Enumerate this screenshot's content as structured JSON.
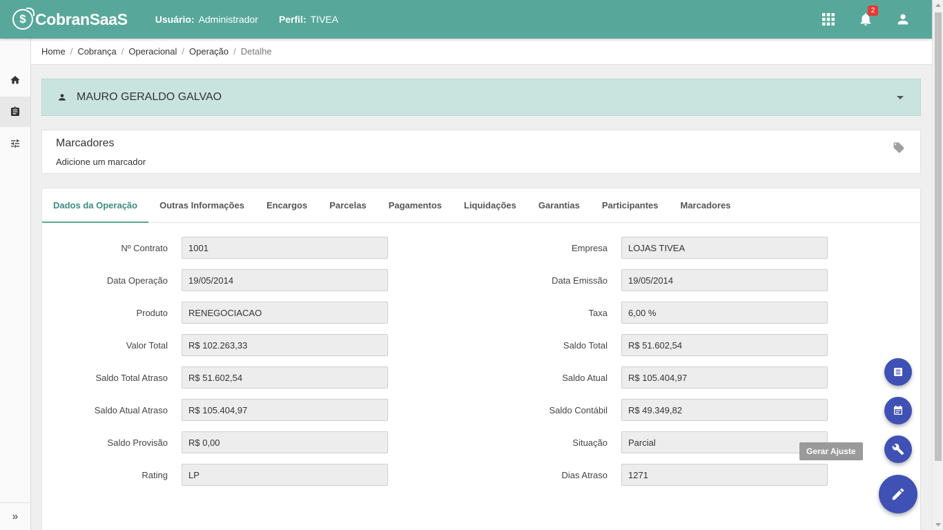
{
  "header": {
    "logo_text": "CobranSaaS",
    "logo_symbol": "$",
    "user_label": "Usuário:",
    "user_value": "Administrador",
    "profile_label": "Perfil:",
    "profile_value": "TIVEA",
    "notification_count": "2",
    "icons": [
      "apps-grid-icon",
      "bell-icon",
      "account-icon"
    ],
    "color": "#57a89a"
  },
  "sidebar": {
    "items": [
      "home-icon",
      "clipboard-icon",
      "sliders-icon"
    ],
    "expand_label": "»"
  },
  "breadcrumb": {
    "items": [
      "Home",
      "Cobrança",
      "Operacional",
      "Operação"
    ],
    "current": "Detalhe"
  },
  "client": {
    "name": "MAURO GERALDO GALVAO"
  },
  "tags": {
    "title": "Marcadores",
    "add_label": "Adicione um marcador"
  },
  "tabs": [
    "Dados da Operação",
    "Outras Informações",
    "Encargos",
    "Parcelas",
    "Pagamentos",
    "Liquidações",
    "Garantias",
    "Participantes",
    "Marcadores"
  ],
  "active_tab": "Dados da Operação",
  "form": {
    "left": [
      {
        "label": "Nº Contrato",
        "value": "1001"
      },
      {
        "label": "Data Operação",
        "value": "19/05/2014"
      },
      {
        "label": "Produto",
        "value": "RENEGOCIACAO"
      },
      {
        "label": "Valor Total",
        "value": "R$ 102.263,33"
      },
      {
        "label": "Saldo Total Atraso",
        "value": "R$ 51.602,54"
      },
      {
        "label": "Saldo Atual Atraso",
        "value": "R$ 105.404,97"
      },
      {
        "label": "Saldo Provisão",
        "value": "R$ 0,00"
      },
      {
        "label": "Rating",
        "value": "LP"
      }
    ],
    "right": [
      {
        "label": "Empresa",
        "value": "LOJAS TIVEA"
      },
      {
        "label": "Data Emissão",
        "value": "19/05/2014"
      },
      {
        "label": "Taxa",
        "value": "6,00 %"
      },
      {
        "label": "Saldo Total",
        "value": "R$ 51.602,54"
      },
      {
        "label": "Saldo Atual",
        "value": "R$ 105.404,97"
      },
      {
        "label": "Saldo Contábil",
        "value": "R$ 49.349,82"
      },
      {
        "label": "Situação",
        "value": "Parcial"
      },
      {
        "label": "Dias Atraso",
        "value": "1271"
      }
    ]
  },
  "fab": {
    "tooltip": "Gerar Ajuste",
    "actions": [
      "document-icon",
      "calendar-icon",
      "wrench-icon",
      "pencil-icon"
    ],
    "color": "#3f51b5"
  }
}
